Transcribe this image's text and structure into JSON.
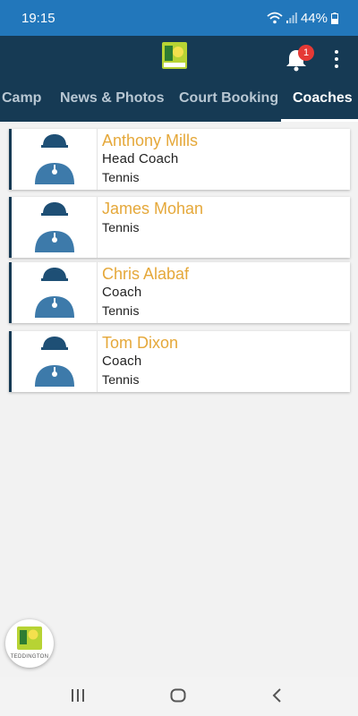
{
  "status_bar": {
    "time": "19:15",
    "battery_percent": "44%",
    "icons": [
      "wifi-icon",
      "signal-icon",
      "battery-icon"
    ]
  },
  "app_bar": {
    "notification_count": "1",
    "icons": [
      "club-logo",
      "bell-icon",
      "more-vertical-icon"
    ]
  },
  "tabs": [
    {
      "label": "Camp",
      "active": false
    },
    {
      "label": "News & Photos",
      "active": false
    },
    {
      "label": "Court Booking",
      "active": false
    },
    {
      "label": "Coaches",
      "active": true
    }
  ],
  "coaches": [
    {
      "name": "Anthony Mills",
      "lines": [
        "Head Coach",
        "Tennis"
      ]
    },
    {
      "name": "James Mohan",
      "lines": [
        "Tennis"
      ]
    },
    {
      "name": "Chris Alabaf",
      "lines": [
        "Coach",
        "Tennis"
      ]
    },
    {
      "name": "Tom Dixon",
      "lines": [
        "Coach",
        "Tennis"
      ]
    }
  ],
  "floating_logo": {
    "text": "TEDDINGTON"
  },
  "colors": {
    "status_bar": "#2277bb",
    "app_bar": "#163a54",
    "coach_name": "#e5a83a",
    "avatar": "#3d7aaa",
    "logo_green": "#b7d334"
  },
  "nav_bar": {
    "icons": [
      "recent-apps-icon",
      "home-icon",
      "back-icon"
    ]
  }
}
